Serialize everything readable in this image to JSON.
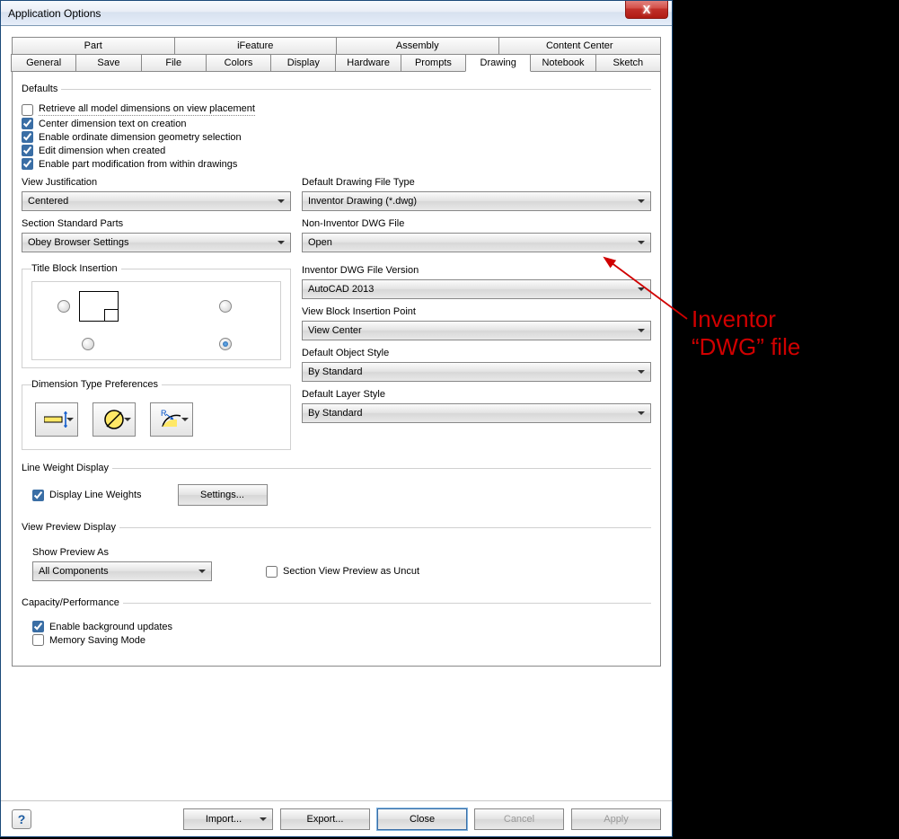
{
  "title": "Application Options",
  "tabs_row1": [
    "Part",
    "iFeature",
    "Assembly",
    "Content Center"
  ],
  "tabs_row2": [
    "General",
    "Save",
    "File",
    "Colors",
    "Display",
    "Hardware",
    "Prompts",
    "Drawing",
    "Notebook",
    "Sketch"
  ],
  "active_tab": "Drawing",
  "defaults": {
    "legend": "Defaults",
    "retrieve": {
      "label": "Retrieve all model dimensions on view placement",
      "checked": false
    },
    "center_dim": {
      "label": "Center dimension text on creation",
      "checked": true
    },
    "enable_ordinate": {
      "label": "Enable ordinate dimension geometry selection",
      "checked": true
    },
    "edit_dim": {
      "label": "Edit dimension when created",
      "checked": true
    },
    "enable_part_mod": {
      "label": "Enable part modification from within drawings",
      "checked": true
    }
  },
  "left": {
    "view_just_label": "View Justification",
    "view_just_value": "Centered",
    "section_std_label": "Section Standard Parts",
    "section_std_value": "Obey Browser Settings",
    "title_block_legend": "Title Block Insertion",
    "dim_type_legend": "Dimension Type Preferences"
  },
  "right": {
    "file_type_label": "Default Drawing File Type",
    "file_type_value": "Inventor Drawing (*.dwg)",
    "non_inv_label": "Non-Inventor DWG File",
    "non_inv_value": "Open",
    "inv_ver_label": "Inventor DWG File Version",
    "inv_ver_value": "AutoCAD 2013",
    "view_block_label": "View Block Insertion Point",
    "view_block_value": "View Center",
    "obj_style_label": "Default Object Style",
    "obj_style_value": "By Standard",
    "layer_style_label": "Default Layer Style",
    "layer_style_value": "By Standard"
  },
  "line_weight": {
    "legend": "Line Weight Display",
    "display_label": "Display Line Weights",
    "display_checked": true,
    "settings_btn": "Settings..."
  },
  "view_preview": {
    "legend": "View Preview Display",
    "show_label": "Show Preview As",
    "show_value": "All Components",
    "uncut_label": "Section View Preview as Uncut",
    "uncut_checked": false
  },
  "capacity": {
    "legend": "Capacity/Performance",
    "bg_label": "Enable background updates",
    "bg_checked": true,
    "mem_label": "Memory Saving Mode",
    "mem_checked": false
  },
  "footer": {
    "import": "Import...",
    "export": "Export...",
    "close": "Close",
    "cancel": "Cancel",
    "apply": "Apply"
  },
  "annotation": {
    "line1": "Inventor",
    "line2": "“DWG” file"
  }
}
